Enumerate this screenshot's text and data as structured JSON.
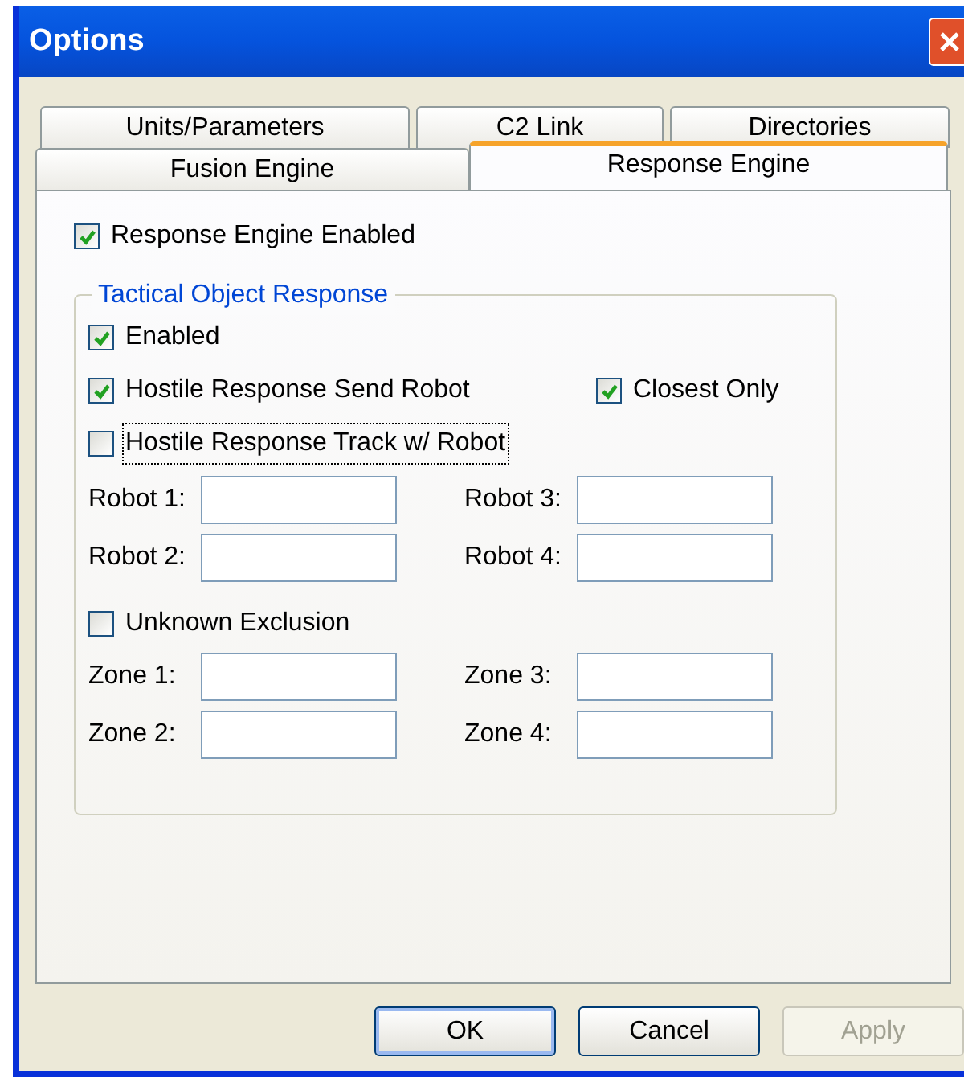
{
  "window": {
    "title": "Options"
  },
  "tab_rows": [
    [
      {
        "label": "Units/Parameters",
        "selected": false
      },
      {
        "label": "C2 Link",
        "selected": false
      },
      {
        "label": "Directories",
        "selected": false
      }
    ],
    [
      {
        "label": "Fusion Engine",
        "selected": false
      },
      {
        "label": "Response Engine",
        "selected": true
      }
    ]
  ],
  "main_checkbox": {
    "label": "Response Engine Enabled",
    "checked": true
  },
  "group": {
    "title": "Tactical Object Response",
    "checkbox_rows": [
      [
        {
          "label": "Enabled",
          "checked": true,
          "focused": false
        }
      ],
      [
        {
          "label": "Hostile Response Send Robot",
          "checked": true,
          "focused": false
        },
        {
          "label": "Closest Only",
          "checked": true,
          "focused": false
        }
      ],
      [
        {
          "label": "Hostile Response Track w/ Robot",
          "checked": false,
          "focused": true
        }
      ]
    ],
    "robot_fields": [
      {
        "label": "Robot 1:"
      },
      {
        "label": "Robot 3:"
      },
      {
        "label": "Robot 2:"
      },
      {
        "label": "Robot 4:"
      }
    ],
    "exclusion": {
      "label": "Unknown Exclusion",
      "checked": false
    },
    "zone_fields": [
      {
        "label": "Zone 1:"
      },
      {
        "label": "Zone 3:"
      },
      {
        "label": "Zone 2:"
      },
      {
        "label": "Zone 4:"
      }
    ]
  },
  "buttons": [
    {
      "label": "OK",
      "default": true,
      "disabled": false
    },
    {
      "label": "Cancel",
      "default": false,
      "disabled": false
    },
    {
      "label": "Apply",
      "default": false,
      "disabled": true
    }
  ]
}
